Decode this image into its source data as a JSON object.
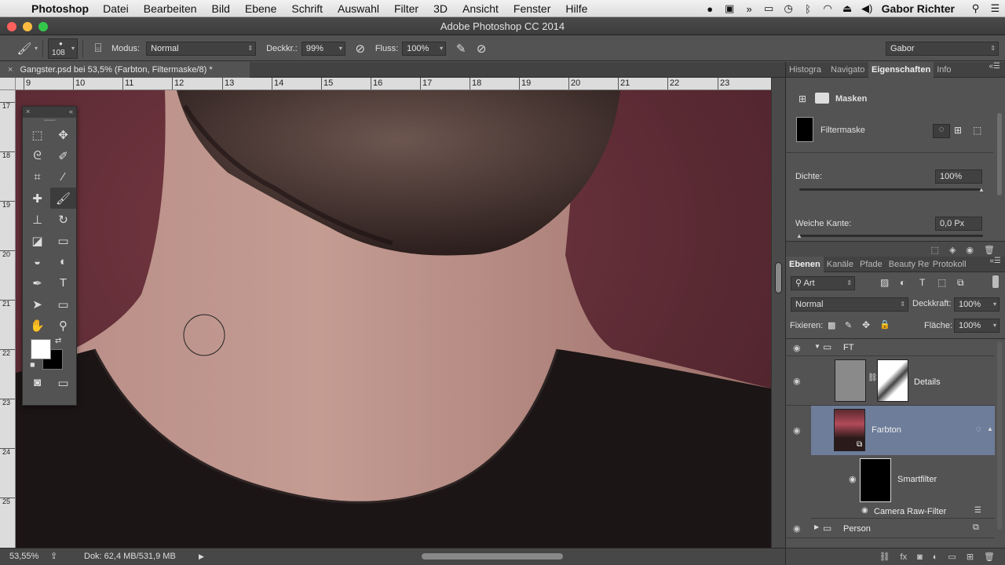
{
  "menubar": {
    "app_name": "Photoshop",
    "items": [
      "Datei",
      "Bearbeiten",
      "Bild",
      "Ebene",
      "Schrift",
      "Auswahl",
      "Filter",
      "3D",
      "Ansicht",
      "Fenster",
      "Hilfe"
    ],
    "user": "Gabor Richter"
  },
  "window": {
    "title": "Adobe Photoshop CC 2014"
  },
  "options": {
    "brush_size": "108",
    "mode_label": "Modus:",
    "mode_value": "Normal",
    "opacity_label": "Deckkr.:",
    "opacity_value": "99%",
    "flow_label": "Fluss:",
    "flow_value": "100%",
    "workspace": "Gabor"
  },
  "document": {
    "tab_title": "Gangster.psd bei 53,5% (Farbton, Filtermaske/8) *",
    "ruler_top": [
      "9",
      "10",
      "11",
      "12",
      "13",
      "14",
      "15",
      "16",
      "17",
      "18",
      "19",
      "20",
      "21",
      "22",
      "23"
    ],
    "ruler_left": [
      "17",
      "18",
      "19",
      "20",
      "21",
      "22",
      "23",
      "24",
      "25"
    ]
  },
  "status": {
    "zoom": "53,55%",
    "doc_info": "Dok: 62,4 MB/531,9 MB"
  },
  "properties_panel": {
    "tabs": [
      "Histogra",
      "Navigato",
      "Eigenschaften",
      "Info"
    ],
    "active_tab": "Eigenschaften",
    "section_title": "Masken",
    "mask_name": "Filtermaske",
    "density_label": "Dichte:",
    "density_value": "100%",
    "feather_label": "Weiche Kante:",
    "feather_value": "0,0 Px"
  },
  "layers_panel": {
    "tabs": [
      "Ebenen",
      "Kanäle",
      "Pfade",
      "Beauty Ret",
      "Protokoll"
    ],
    "active_tab": "Ebenen",
    "filter_kind": "Art",
    "blend_mode": "Normal",
    "opacity_label": "Deckkraft:",
    "opacity_value": "100%",
    "lock_label": "Fixieren:",
    "fill_label": "Fläche:",
    "fill_value": "100%",
    "layers": [
      {
        "name": "FT",
        "type": "group",
        "expanded": true
      },
      {
        "name": "Details",
        "type": "adjustment"
      },
      {
        "name": "Farbton",
        "type": "smart-object",
        "selected": true
      },
      {
        "name": "Smartfilter",
        "type": "smart-filter-mask"
      },
      {
        "name": "Camera Raw-Filter",
        "type": "filter"
      },
      {
        "name": "Person",
        "type": "group",
        "expanded": false
      }
    ]
  },
  "colors": {
    "selected_layer": "#6d7d9a",
    "foreground": "#ffffff",
    "background": "#000000"
  }
}
